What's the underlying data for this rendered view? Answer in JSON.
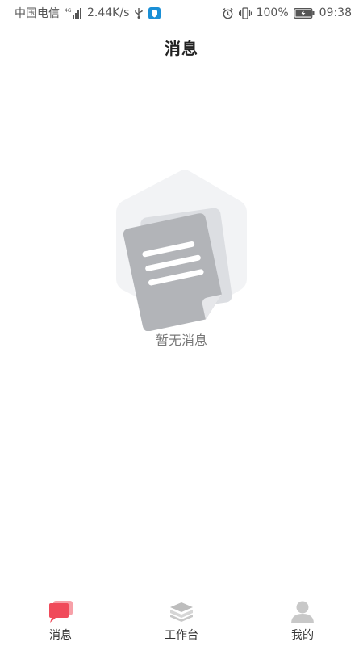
{
  "status_bar": {
    "carrier": "中国电信",
    "network_type": "4G",
    "speed": "2.44K/s",
    "battery_percent": "100%",
    "time": "09:38",
    "icons": [
      "signal-icon",
      "usb-icon",
      "shield-app-icon",
      "alarm-icon",
      "vibrate-icon",
      "battery-icon"
    ]
  },
  "header": {
    "title": "消息"
  },
  "empty_state": {
    "message": "暂无消息",
    "icon": "document-icon"
  },
  "tab_bar": {
    "active_color": "#f04a5a",
    "inactive_color": "#c8c8c8",
    "tabs": [
      {
        "label": "消息",
        "icon": "message-icon",
        "active": true
      },
      {
        "label": "工作台",
        "icon": "layers-icon",
        "active": false
      },
      {
        "label": "我的",
        "icon": "user-icon",
        "active": false
      }
    ]
  }
}
